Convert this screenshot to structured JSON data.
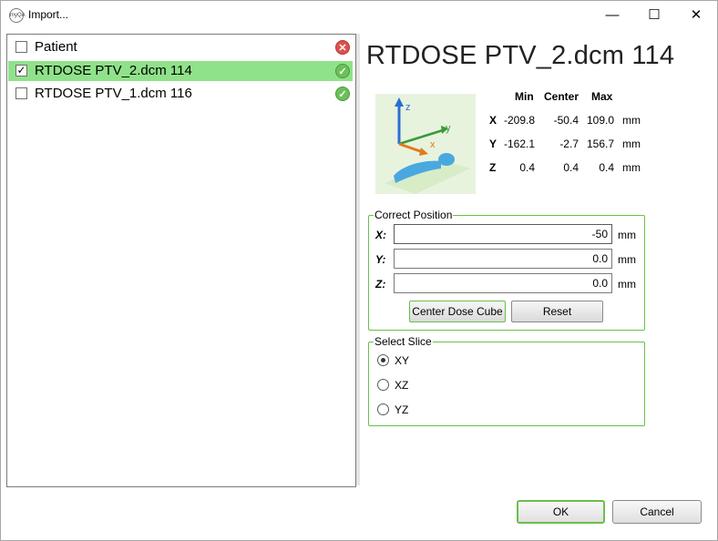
{
  "window": {
    "title": "Import...",
    "app_icon_text": "myQA",
    "minimize": "—",
    "maximize": "☐",
    "close": "✕"
  },
  "file_list": [
    {
      "label": "Patient",
      "checked": false,
      "selected": false,
      "status": "error",
      "status_glyph": "✕",
      "check_glyph": ""
    },
    {
      "label": "RTDOSE PTV_2.dcm 114",
      "checked": true,
      "selected": true,
      "status": "ok",
      "status_glyph": "✓",
      "check_glyph": "✓"
    },
    {
      "label": "RTDOSE PTV_1.dcm 116",
      "checked": false,
      "selected": false,
      "status": "ok",
      "status_glyph": "✓",
      "check_glyph": ""
    }
  ],
  "detail": {
    "file_title": "RTDOSE PTV_2.dcm 114",
    "preview_axes": {
      "z": "z",
      "y": "y",
      "x": "x"
    },
    "stats": {
      "headers": [
        "Min",
        "Center",
        "Max"
      ],
      "rows": [
        {
          "axis": "X",
          "min": "-209.8",
          "center": "-50.4",
          "max": "109.0",
          "unit": "mm"
        },
        {
          "axis": "Y",
          "min": "-162.1",
          "center": "-2.7",
          "max": "156.7",
          "unit": "mm"
        },
        {
          "axis": "Z",
          "min": "0.4",
          "center": "0.4",
          "max": "0.4",
          "unit": "mm"
        }
      ]
    },
    "correct_position": {
      "title": "Correct Position",
      "x_label": "X:",
      "x_value": "-50",
      "x_unit": "mm",
      "y_label": "Y:",
      "y_value": "0.0",
      "y_unit": "mm",
      "z_label": "Z:",
      "z_value": "0.0",
      "z_unit": "mm",
      "center_button": "Center Dose Cube",
      "reset_button": "Reset"
    },
    "select_slice": {
      "title": "Select Slice",
      "options": [
        "XY",
        "XZ",
        "YZ"
      ],
      "selected": "XY"
    }
  },
  "footer": {
    "ok": "OK",
    "cancel": "Cancel"
  },
  "colors": {
    "selection": "#90e28a",
    "group_border": "#6cbf4a",
    "error": "#d9534f",
    "ok": "#6cbf5a"
  }
}
